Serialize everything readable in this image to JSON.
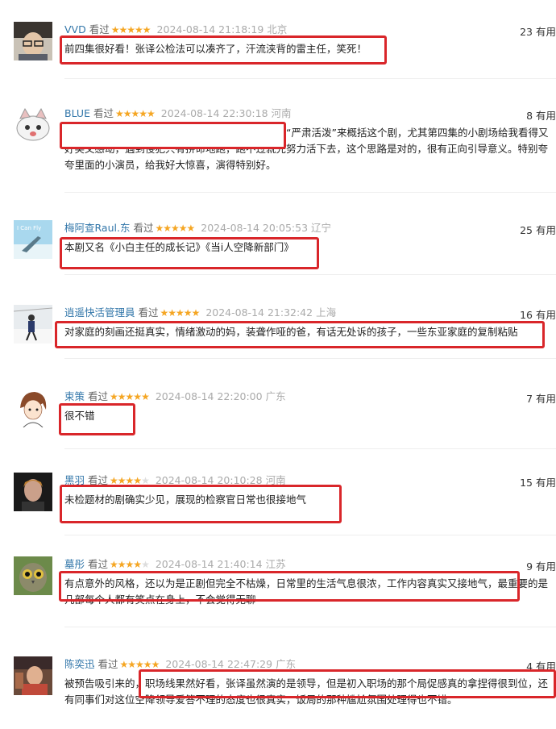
{
  "comments": [
    {
      "user": "VVD",
      "seen": "看过",
      "stars": 5,
      "time": "2024-08-14 21:18:19",
      "loc": "北京",
      "useful": "23 有用",
      "text": "前四集很好看！张译公检法可以凑齐了，汗流浃背的雷主任，笑死！"
    },
    {
      "user": "BLUE",
      "seen": "看过",
      "stars": 5,
      "time": "2024-08-14 22:30:18",
      "loc": "河南",
      "useful": "8 有用",
      "text": "未检这一块儿真没咋了解过，还挺多科普的。想用“严肃活泼”来概括这个剧，尤其第四集的小剧场给我看得又好笑又感动，遇到侵犯只有拼命地跑，跑不过就先努力活下去，这个思路是对的，很有正向引导意义。特别夸夸里面的小演员，给我好大惊喜，演得特别好。"
    },
    {
      "user": "梅阿查Raul.东",
      "seen": "看过",
      "stars": 5,
      "time": "2024-08-14 20:05:53",
      "loc": "辽宁",
      "useful": "25 有用",
      "text": "本剧又名《小白主任的成长记》《当i人空降新部门》"
    },
    {
      "user": "逍遥快活管理員",
      "seen": "看过",
      "stars": 5,
      "time": "2024-08-14 21:32:42",
      "loc": "上海",
      "useful": "16 有用",
      "text": "对家庭的刻画还挺真实，情绪激动的妈，装聋作哑的爸，有话无处诉的孩子，一些东亚家庭的复制粘贴"
    },
    {
      "user": "束策",
      "seen": "看过",
      "stars": 5,
      "time": "2024-08-14 22:20:00",
      "loc": "广东",
      "useful": "7 有用",
      "text": "很不错"
    },
    {
      "user": "黑羽",
      "seen": "看过",
      "stars": 4,
      "time": "2024-08-14 20:10:28",
      "loc": "河南",
      "useful": "15 有用",
      "text": "未检题材的剧确实少见，展现的检察官日常也很接地气"
    },
    {
      "user": "墓彤",
      "seen": "看过",
      "stars": 4,
      "time": "2024-08-14 21:40:14",
      "loc": "江苏",
      "useful": "9 有用",
      "text": "有点意外的风格，还以为是正剧但完全不枯燥，日常里的生活气息很浓，工作内容真实又接地气，最重要的是几部每个人都有笑点在身上，不会觉得无聊"
    },
    {
      "user": "陈奕迅",
      "seen": "看过",
      "stars": 5,
      "time": "2024-08-14 22:47:29",
      "loc": "广东",
      "useful": "4 有用",
      "text": "被预告吸引来的，职场线果然好看，张译虽然演的是领导，但是初入职场的那个局促感真的拿捏得很到位，还有同事们对这位空降领导爱答不理的态度也很真实，饭局的那种尴尬氛围处理得也不错。"
    }
  ],
  "colors": {
    "highlight": "#d9262a",
    "username": "#3377aa",
    "star": "#f5a623"
  }
}
